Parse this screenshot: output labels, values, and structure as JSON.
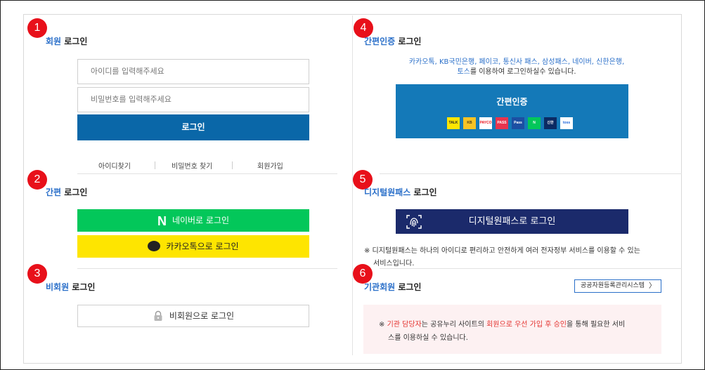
{
  "member_login": {
    "badge": "1",
    "title_highlight": "회원",
    "title_rest": " 로그인",
    "id_placeholder": "아이디를 입력해주세요",
    "pw_placeholder": "비밀번호를 입력해주세요",
    "login_button": "로그인",
    "links": [
      "아이디찾기",
      "비밀번호 찾기",
      "회원가입"
    ]
  },
  "easy_login": {
    "badge": "2",
    "title_highlight": "간편",
    "title_rest": " 로그인",
    "naver_glyph": "N",
    "naver_button": "네이버로 로그인",
    "kakao_button": "카카오톡으로 로그인"
  },
  "guest_login": {
    "badge": "3",
    "title_highlight": "비회원",
    "title_rest": " 로그인",
    "button": "비회원으로 로그인"
  },
  "simple_auth": {
    "badge": "4",
    "title_highlight": "간편인증",
    "title_rest": " 로그인",
    "desc_line1": "카카오톡, KB국민은행, 페이코, 통신사 패스, 삼성패스, 네이버, 신한은행,",
    "desc_line2_blue": "토스",
    "desc_line2_rest": "를 이용하여 로그인하실수 있습니다.",
    "button": "간편인증",
    "providers": [
      {
        "name": "kakao",
        "label": "TALK",
        "bg": "#fee500",
        "fg": "#222222"
      },
      {
        "name": "kb",
        "label": "KB",
        "bg": "#f7c325",
        "fg": "#4a3b17"
      },
      {
        "name": "payco",
        "label": "PAYCO",
        "bg": "#ffffff",
        "fg": "#e8101a"
      },
      {
        "name": "pass",
        "label": "PASS",
        "bg": "#e8344e",
        "fg": "#ffffff"
      },
      {
        "name": "samsung-pass",
        "label": "Pass",
        "bg": "#1c4fa3",
        "fg": "#ffffff"
      },
      {
        "name": "naver",
        "label": "N",
        "bg": "#03c75a",
        "fg": "#ffffff"
      },
      {
        "name": "shinhan",
        "label": "신한",
        "bg": "#0b2a63",
        "fg": "#ffffff"
      },
      {
        "name": "toss",
        "label": "toss",
        "bg": "#ffffff",
        "fg": "#1b64da"
      }
    ]
  },
  "digital_onepass": {
    "badge": "5",
    "title_highlight": "디지털원패스",
    "title_rest": " 로그인",
    "button": "디지털원패스로 로그인",
    "note_line1": "※ 디지털원패스는 하나의 아이디로 편리하고 안전하게 여러 전자정부 서비스를 이용할 수 있는",
    "note_line2": "서비스입니다."
  },
  "agency_login": {
    "badge": "6",
    "title_highlight": "기관회원",
    "title_rest": " 로그인",
    "register_button": "공공자원등록관리시스템",
    "register_chevron": "〉",
    "notice_prefix": "※ ",
    "notice_red1": "기관 담당자",
    "notice_mid": "는 공유누리 사이트의 ",
    "notice_red2": "회원으로 우선 가입 후 승인",
    "notice_end": "을 통해 필요한 서비",
    "notice_line2": "스를 이용하실 수 있습니다."
  },
  "colors": {
    "badge": "#e8101a",
    "highlight": "#2a6fc9",
    "login_button": "#0a67a8",
    "naver": "#03c75a",
    "kakao": "#fee500",
    "simple_auth": "#1479b8",
    "digital_onepass": "#1b2a6b",
    "notice_bg": "#fdf1f2",
    "notice_red": "#e4322f"
  }
}
